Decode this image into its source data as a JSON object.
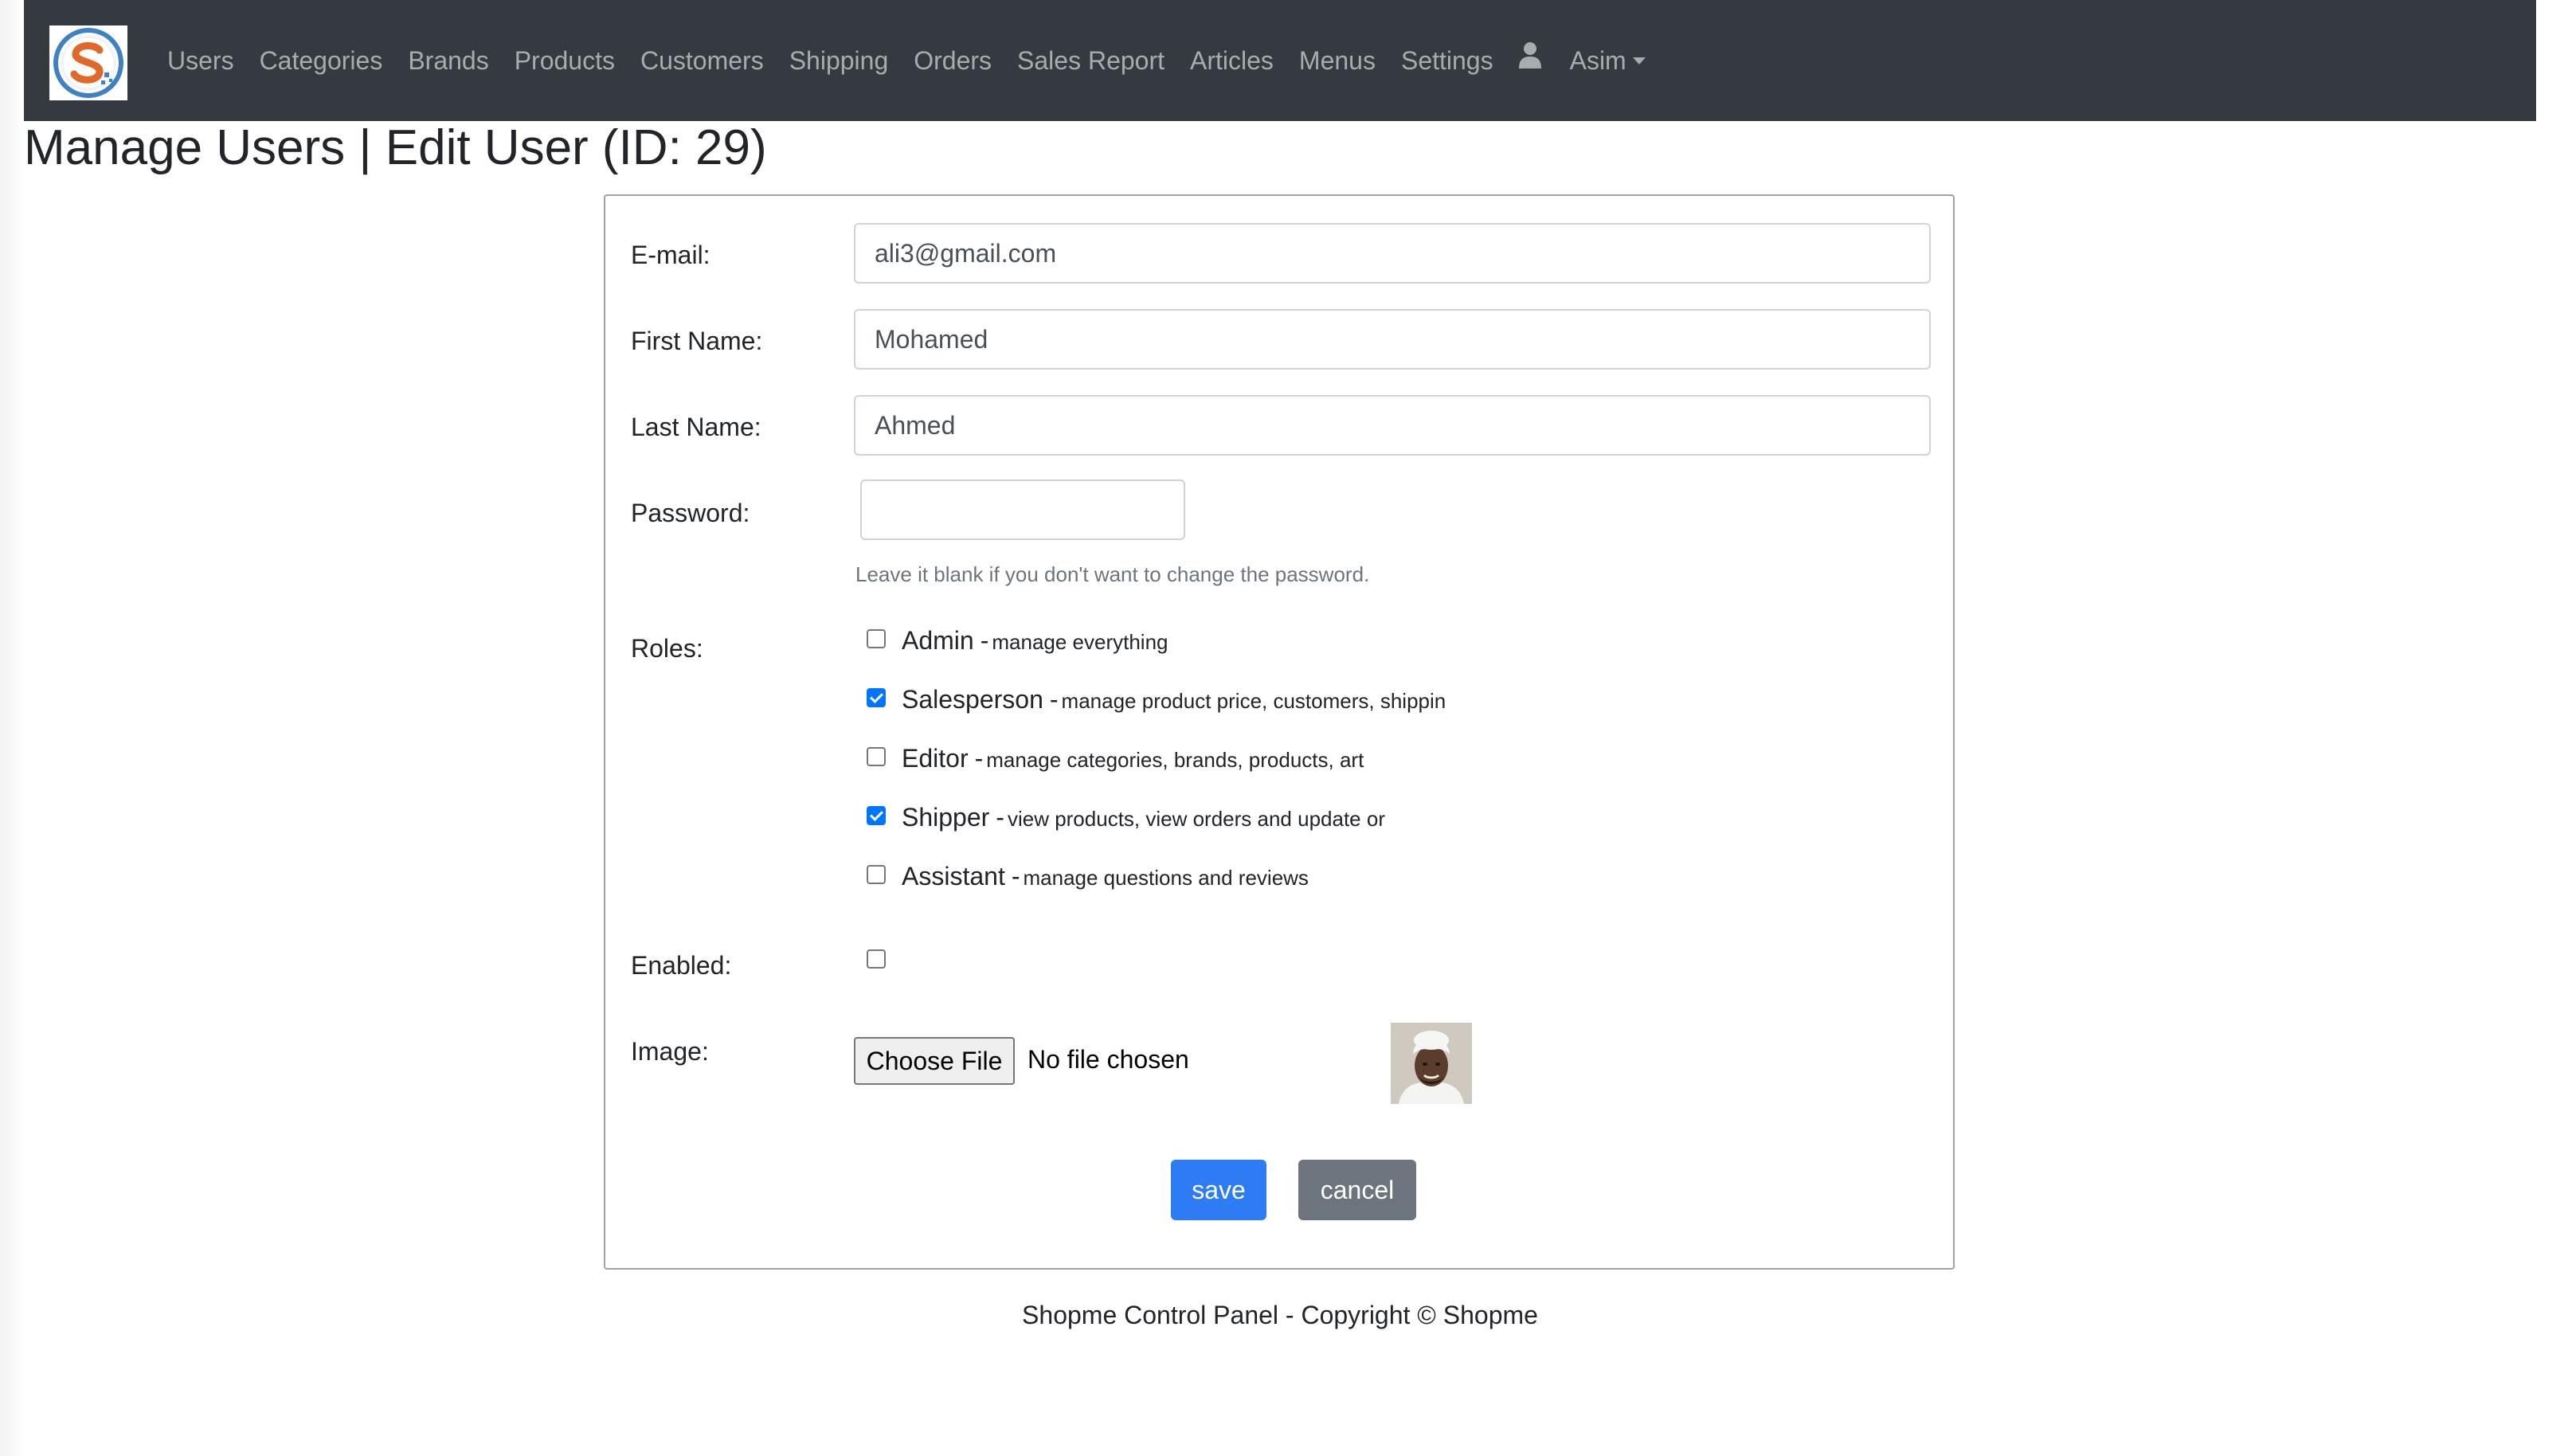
{
  "nav": {
    "links": [
      "Users",
      "Categories",
      "Brands",
      "Products",
      "Customers",
      "Shipping",
      "Orders",
      "Sales Report",
      "Articles",
      "Menus",
      "Settings"
    ],
    "user_name": "Asim"
  },
  "page": {
    "title": "Manage Users | Edit User (ID: 29)"
  },
  "form": {
    "email_label": "E-mail:",
    "email_value": "ali3@gmail.com",
    "first_name_label": "First Name:",
    "first_name_value": "Mohamed",
    "last_name_label": "Last Name:",
    "last_name_value": "Ahmed",
    "password_label": "Password:",
    "password_value": "",
    "password_hint": "Leave it blank if you don't want to change the password.",
    "roles_label": "Roles:",
    "roles": [
      {
        "name": "Admin",
        "desc": "manage everything",
        "checked": false
      },
      {
        "name": "Salesperson",
        "desc": "manage product price, customers, shippin",
        "checked": true
      },
      {
        "name": "Editor",
        "desc": "manage categories, brands, products, art",
        "checked": false
      },
      {
        "name": "Shipper",
        "desc": "view products, view orders and update or",
        "checked": true
      },
      {
        "name": "Assistant",
        "desc": "manage questions and reviews",
        "checked": false
      }
    ],
    "role_separator": "-",
    "enabled_label": "Enabled:",
    "enabled": false,
    "image_label": "Image:",
    "choose_file_label": "Choose File",
    "file_status": "No file chosen",
    "save_label": "save",
    "cancel_label": "cancel"
  },
  "footer": {
    "text": "Shopme Control Panel - Copyright © Shopme"
  },
  "colors": {
    "navbar_bg": "#343a40",
    "nav_text": "#a9acaf",
    "primary": "#2d7cf3",
    "secondary": "#6c757d",
    "checkbox_checked": "#0075ff"
  }
}
